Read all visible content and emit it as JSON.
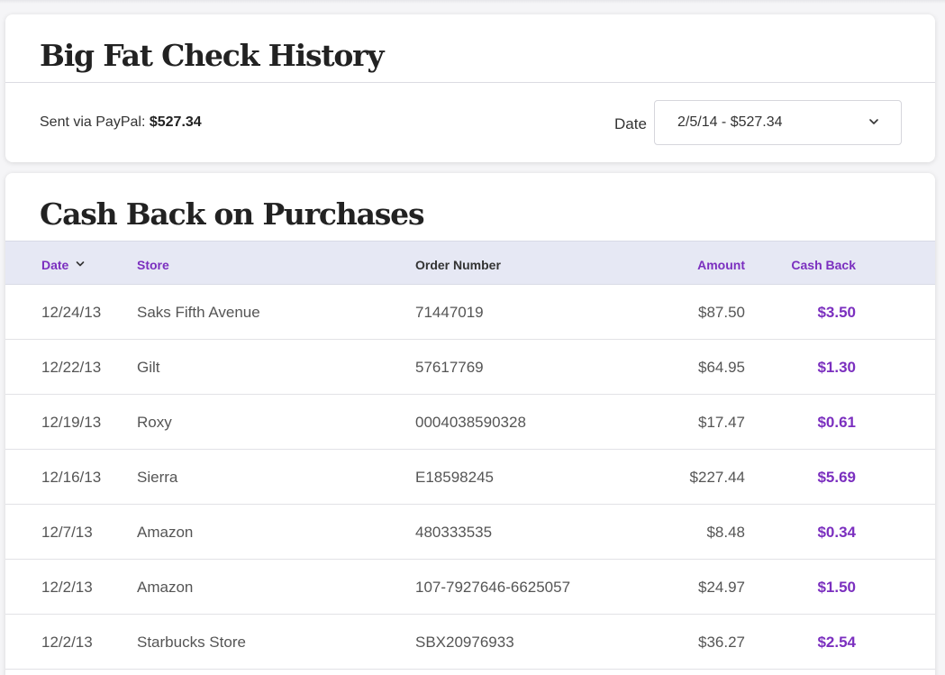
{
  "history": {
    "title": "Big Fat Check History",
    "sent_label": "Sent via PayPal:",
    "sent_amount": "$527.34",
    "date_label": "Date",
    "date_selected": "2/5/14 - $527.34"
  },
  "cashback": {
    "title": "Cash Back on Purchases",
    "columns": {
      "date": "Date",
      "store": "Store",
      "order": "Order Number",
      "amount": "Amount",
      "cash_back": "Cash Back"
    },
    "rows": [
      {
        "date": "12/24/13",
        "store": "Saks Fifth Avenue",
        "order": "71447019",
        "amount": "$87.50",
        "cash_back": "$3.50"
      },
      {
        "date": "12/22/13",
        "store": "Gilt",
        "order": "57617769",
        "amount": "$64.95",
        "cash_back": "$1.30"
      },
      {
        "date": "12/19/13",
        "store": "Roxy",
        "order": "0004038590328",
        "amount": "$17.47",
        "cash_back": "$0.61"
      },
      {
        "date": "12/16/13",
        "store": "Sierra",
        "order": "E18598245",
        "amount": "$227.44",
        "cash_back": "$5.69"
      },
      {
        "date": "12/7/13",
        "store": "Amazon",
        "order": "480333535",
        "amount": "$8.48",
        "cash_back": "$0.34"
      },
      {
        "date": "12/2/13",
        "store": "Amazon",
        "order": "107-7927646-6625057",
        "amount": "$24.97",
        "cash_back": "$1.50"
      },
      {
        "date": "12/2/13",
        "store": "Starbucks Store",
        "order": "SBX20976933",
        "amount": "$36.27",
        "cash_back": "$2.54"
      }
    ]
  },
  "colors": {
    "accent": "#7b2fbf",
    "header_bg": "#e6e8f4"
  },
  "icons": {
    "dropdown": "chevron-down-icon",
    "sort": "sort-descending-icon"
  }
}
